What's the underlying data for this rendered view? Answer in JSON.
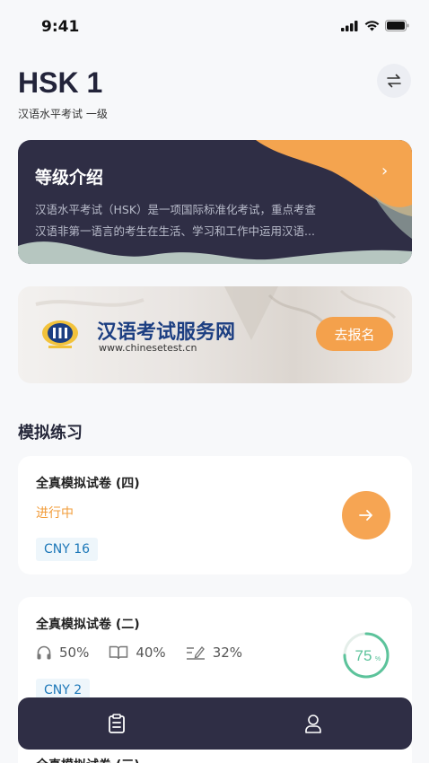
{
  "status_bar": {
    "time": "9:41"
  },
  "header": {
    "title": "HSK 1",
    "subtitle": "汉语水平考试 一级"
  },
  "intro_card": {
    "title": "等级介绍",
    "line1": "汉语水平考试（HSK）是一项国际标准化考试，重点考查",
    "line2": "汉语非第一语言的考生在生活、学习和工作中运用汉语..."
  },
  "banner": {
    "brand": "汉语考试服务网",
    "url": "www.chinesetest.cn",
    "register_label": "去报名"
  },
  "practice": {
    "heading": "模拟练习",
    "cards": [
      {
        "name": "全真模拟试卷 (四)",
        "status": "进行中",
        "price": "CNY 16"
      },
      {
        "name": "全真模拟试卷 (二)",
        "listening": "50%",
        "reading": "40%",
        "writing": "32%",
        "score": "75",
        "score_unit": "%",
        "score_fraction": 0.75,
        "price": "CNY 2"
      },
      {
        "name": "全真模拟试卷 (三)"
      }
    ]
  },
  "colors": {
    "accent": "#f6a553",
    "dark": "#2f2e45",
    "progress": "#5cc39b",
    "price_text": "#1c77b8"
  }
}
